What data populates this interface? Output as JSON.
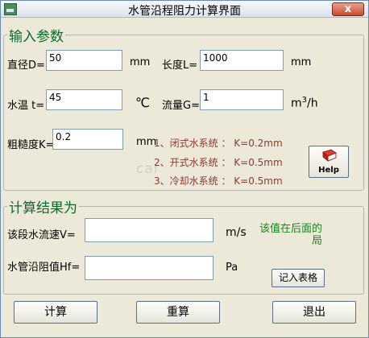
{
  "window": {
    "title": "水管沿程阻力计算界面",
    "close_label": "x"
  },
  "input_group": {
    "title": "输入参数",
    "diameter": {
      "label": "直径D=",
      "value": "50",
      "unit": "mm"
    },
    "length": {
      "label": "长度L=",
      "value": "1000",
      "unit": "mm"
    },
    "temperature": {
      "label": "水温 t=",
      "value": "45",
      "unit": "℃"
    },
    "flow": {
      "label": "流量G=",
      "value": "1",
      "unit_prefix": "m",
      "unit_sup": "3",
      "unit_suffix": "/h"
    },
    "roughness": {
      "label": "粗糙度K=",
      "value": "0.2",
      "unit": "mm"
    },
    "notes": [
      "1、闭式水系统 ： K=0.2mm",
      "2、开式水系统 ： K=0.5mm",
      "3、冷却水系统 ： K=0.5mm"
    ],
    "watermark": "car",
    "help_label": "Help",
    "help_icon": "book-icon"
  },
  "result_group": {
    "title": "计算结果为",
    "velocity": {
      "label": "该段水流速V=",
      "value": "",
      "unit": "m/s"
    },
    "resistance": {
      "label": "水管沿阻值Hf=",
      "value": "",
      "unit": "Pa"
    },
    "hint_line1": "该值在后面的",
    "hint_line2": "局",
    "record_button": "记入表格"
  },
  "footer": {
    "calculate": "计算",
    "recalculate": "重算",
    "exit": "退出"
  },
  "colors": {
    "group_title": "#0a6b2a",
    "note_text": "#8a3b32",
    "hint_text": "#158a1f"
  }
}
